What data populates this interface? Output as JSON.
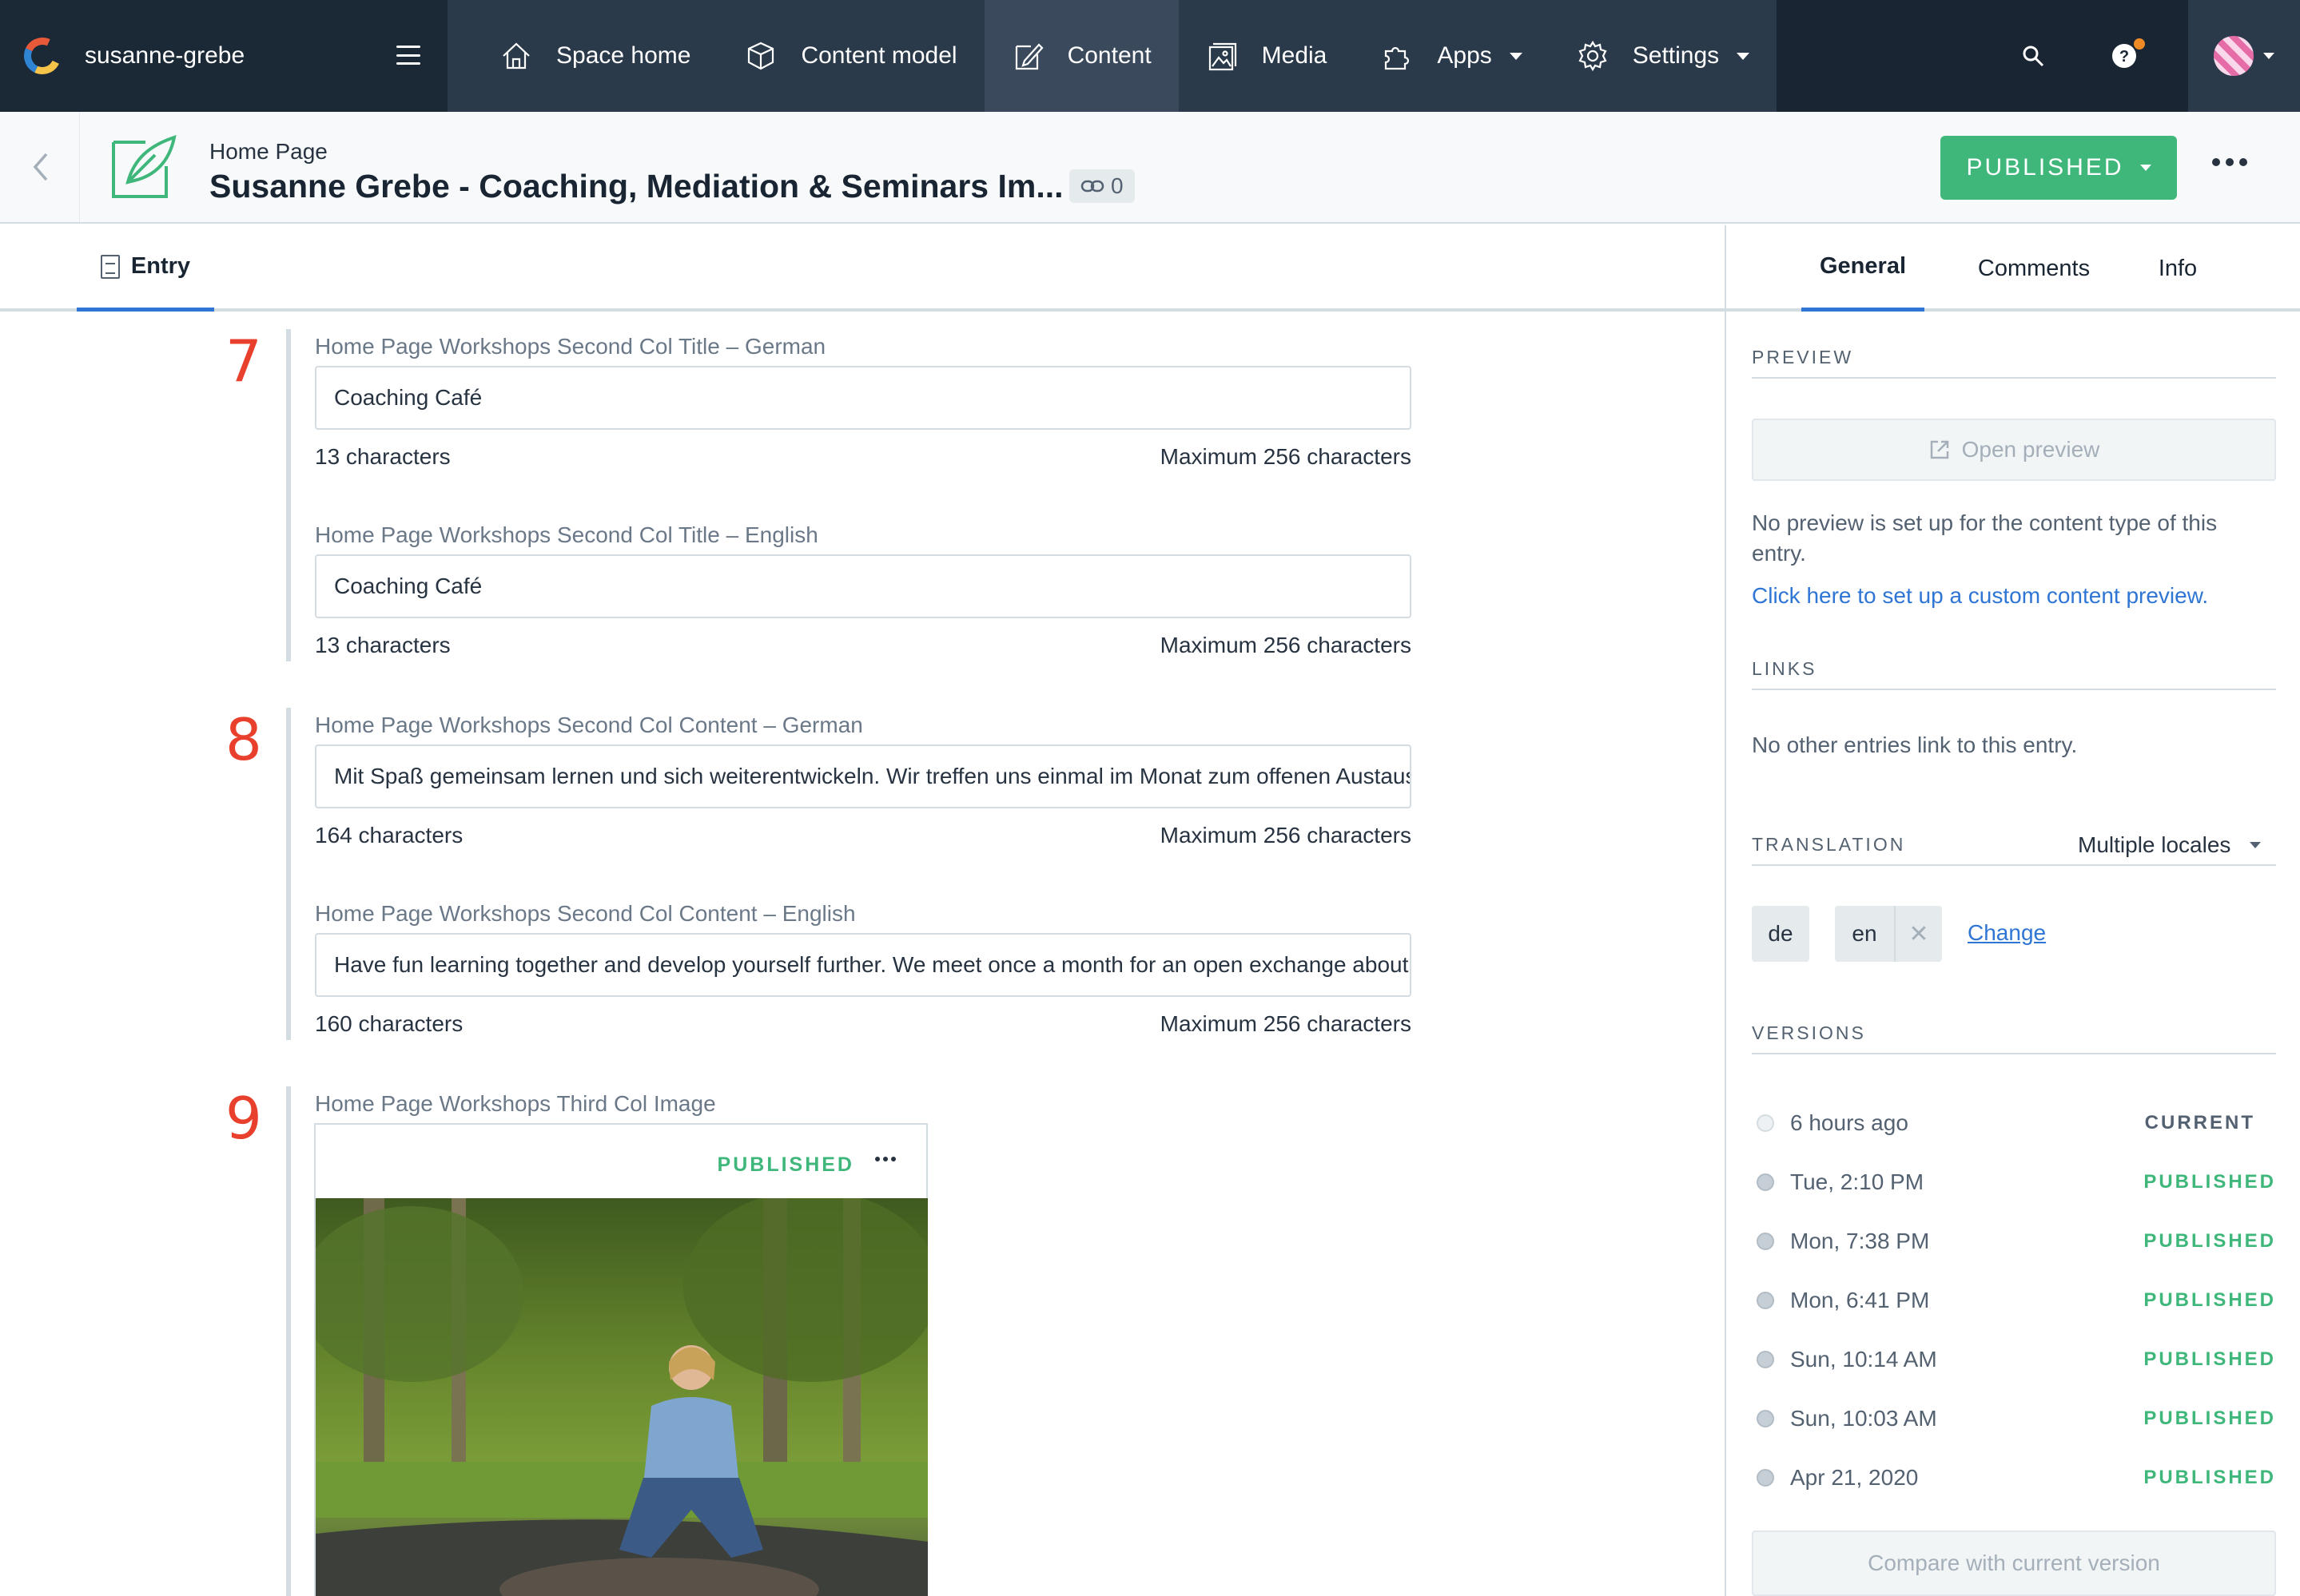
{
  "space": {
    "name": "susanne-grebe"
  },
  "nav": {
    "items": [
      {
        "label": "Space home",
        "icon": "home-icon"
      },
      {
        "label": "Content model",
        "icon": "cube-icon"
      },
      {
        "label": "Content",
        "icon": "edit-icon",
        "active": true
      },
      {
        "label": "Media",
        "icon": "media-icon"
      },
      {
        "label": "Apps",
        "icon": "puzzle-icon"
      },
      {
        "label": "Settings",
        "icon": "gear-icon"
      }
    ]
  },
  "entry": {
    "content_type": "Home Page",
    "title": "Susanne Grebe - Coaching, Mediation & Seminars Im...",
    "link_count": "0",
    "status_button": "PUBLISHED"
  },
  "tabs": {
    "entry": "Entry",
    "general": "General",
    "comments": "Comments",
    "info": "Info"
  },
  "fields": {
    "group7": {
      "number": "7",
      "de_label": "Home Page Workshops Second Col Title – German",
      "de_value": "Coaching Café",
      "de_count": "13 characters",
      "en_label": "Home Page Workshops Second Col Title – English",
      "en_value": "Coaching Café",
      "en_count": "13 characters",
      "max": "Maximum 256 characters"
    },
    "group8": {
      "number": "8",
      "de_label": "Home Page Workshops Second Col Content – German",
      "de_value": "Mit Spaß gemeinsam lernen und sich weiterentwickeln. Wir treffen uns einmal im Monat zum offenen Austausch",
      "de_count": "164 characters",
      "en_label": "Home Page Workshops Second Col Content – English",
      "en_value": "Have fun learning together and develop yourself further. We meet once a month for an open exchange about",
      "en_count": "160 characters",
      "max": "Maximum 256 characters"
    },
    "group9": {
      "number": "9",
      "label": "Home Page Workshops Third Col Image",
      "asset_status": "PUBLISHED"
    }
  },
  "sidebar": {
    "preview_heading": "PREVIEW",
    "open_preview": "Open preview",
    "no_preview_text": "No preview is set up for the content type of this entry.",
    "custom_preview_link": "Click here to set up a custom content preview.",
    "links_heading": "LINKS",
    "links_text": "No other entries link to this entry.",
    "translation_heading": "TRANSLATION",
    "locale_mode": "Multiple locales",
    "locales": [
      "de",
      "en"
    ],
    "change_link": "Change",
    "versions_heading": "VERSIONS",
    "versions": [
      {
        "date": "6 hours ago",
        "status": "CURRENT"
      },
      {
        "date": "Tue, 2:10 PM",
        "status": "PUBLISHED"
      },
      {
        "date": "Mon, 7:38 PM",
        "status": "PUBLISHED"
      },
      {
        "date": "Mon, 6:41 PM",
        "status": "PUBLISHED"
      },
      {
        "date": "Sun, 10:14 AM",
        "status": "PUBLISHED"
      },
      {
        "date": "Sun, 10:03 AM",
        "status": "PUBLISHED"
      },
      {
        "date": "Apr 21, 2020",
        "status": "PUBLISHED"
      }
    ],
    "compare_button": "Compare with current version"
  },
  "colors": {
    "nav_bg": "#192532",
    "accent": "#2e75d4",
    "published": "#3fb77b",
    "field_number": "#e8402c"
  }
}
